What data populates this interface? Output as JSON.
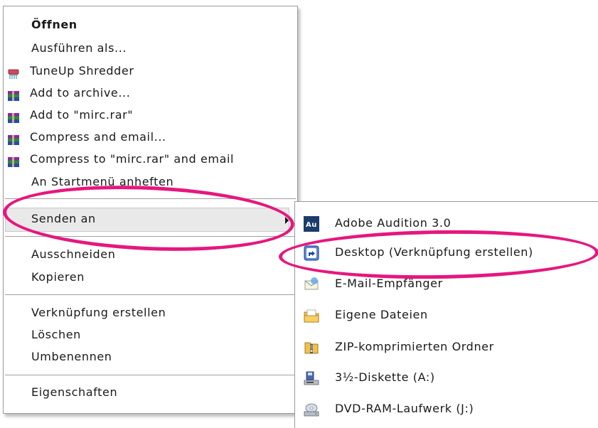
{
  "menu": {
    "items": [
      {
        "label": "Öffnen",
        "icon": null
      },
      {
        "label": "Ausführen als...",
        "icon": null
      },
      {
        "label": "TuneUp Shredder",
        "icon": "shredder-icon"
      },
      {
        "label": "Add to archive...",
        "icon": "winrar-icon"
      },
      {
        "label": "Add to \"mirc.rar\"",
        "icon": "winrar-icon"
      },
      {
        "label": "Compress and email...",
        "icon": "winrar-icon"
      },
      {
        "label": "Compress to \"mirc.rar\" and email",
        "icon": "winrar-icon"
      },
      {
        "label": "An Startmenü anheften",
        "icon": null
      },
      {
        "label": "Senden an",
        "icon": null,
        "has_submenu": true
      },
      {
        "label": "Ausschneiden",
        "icon": null
      },
      {
        "label": "Kopieren",
        "icon": null
      },
      {
        "label": "Verknüpfung erstellen",
        "icon": null
      },
      {
        "label": "Löschen",
        "icon": null
      },
      {
        "label": "Umbenennen",
        "icon": null
      },
      {
        "label": "Eigenschaften",
        "icon": null
      }
    ]
  },
  "submenu": {
    "items": [
      {
        "label": "Adobe Audition 3.0",
        "icon": "adobe-audition-icon"
      },
      {
        "label": "Desktop (Verknüpfung erstellen)",
        "icon": "desktop-shortcut-icon"
      },
      {
        "label": "E-Mail-Empfänger",
        "icon": "mail-recipient-icon"
      },
      {
        "label": "Eigene Dateien",
        "icon": "my-documents-icon"
      },
      {
        "label": "ZIP-komprimierten Ordner",
        "icon": "zip-folder-icon"
      },
      {
        "label": "3½-Diskette (A:)",
        "icon": "floppy-drive-icon"
      },
      {
        "label": "DVD-RAM-Laufwerk (J:)",
        "icon": "dvd-drive-icon"
      }
    ]
  },
  "colors": {
    "annotation": "#e6177e",
    "highlight": "#e9e9e9",
    "border": "#9a9a9a"
  }
}
